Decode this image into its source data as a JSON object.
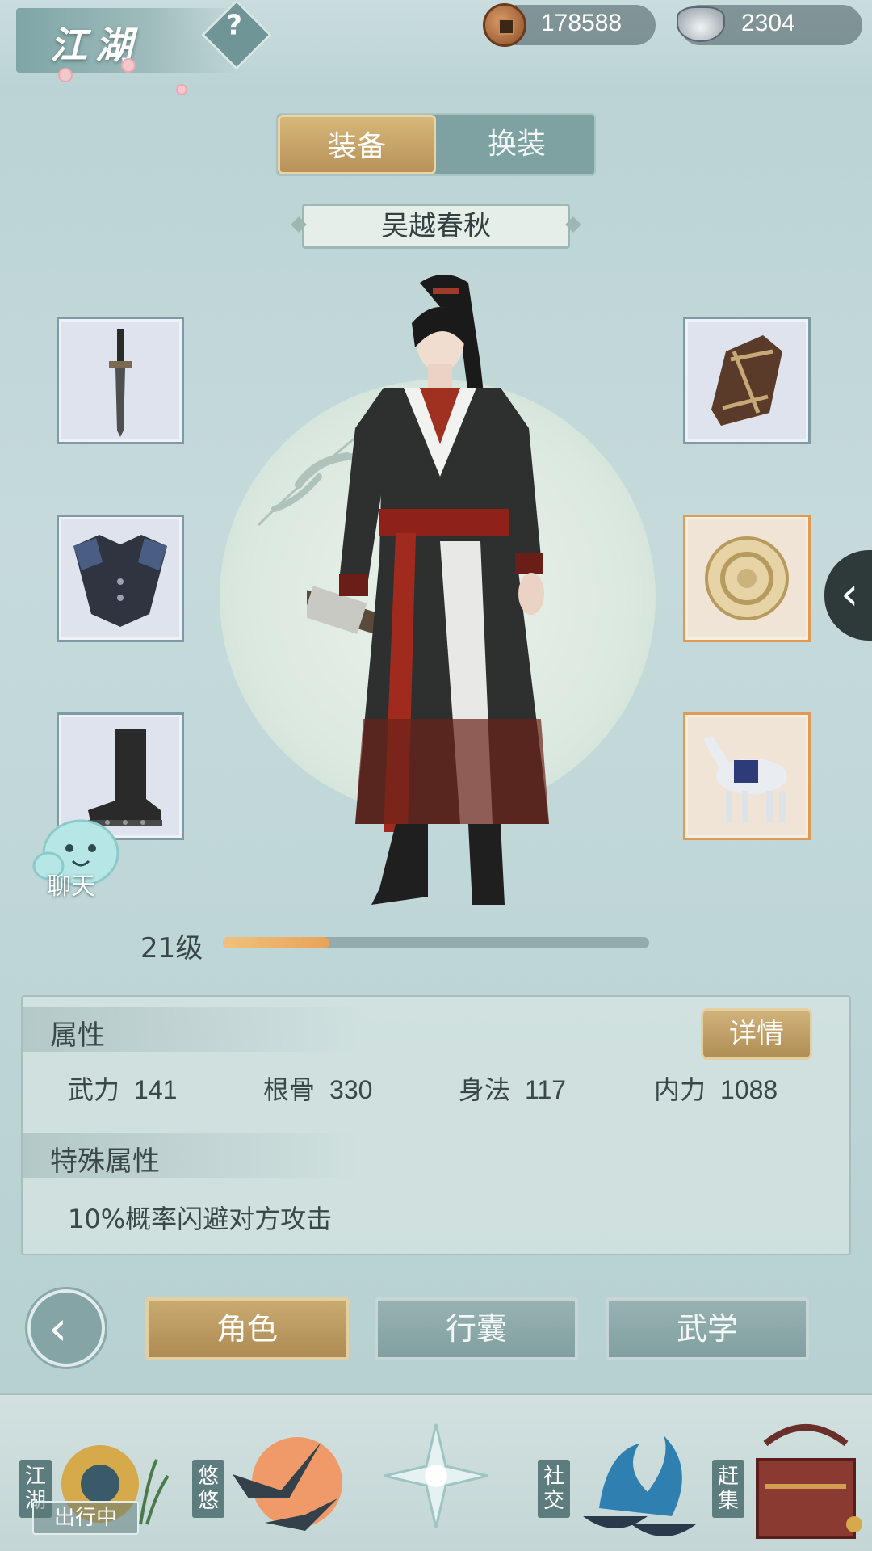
{
  "header": {
    "scene_title": "江湖",
    "help_symbol": "?",
    "currencies": [
      {
        "icon": "copper-coin-icon",
        "value": "178588"
      },
      {
        "icon": "silver-ingot-icon",
        "value": "2304"
      }
    ]
  },
  "tabs": {
    "active": "装备",
    "inactive": "换装"
  },
  "character": {
    "name": "吴越春秋",
    "level_label": "21级",
    "xp_fraction": 0.25
  },
  "equipment": {
    "left": [
      "sword-icon",
      "chest-armor-icon",
      "boots-icon"
    ],
    "right": [
      "bracer-icon",
      "jade-pendant-icon",
      "horse-mount-icon"
    ]
  },
  "side_toggle": "‹",
  "chat": {
    "label": "聊天"
  },
  "attributes": {
    "title": "属性",
    "detail_button": "详情",
    "stats": [
      {
        "name": "武力",
        "value": "141"
      },
      {
        "name": "根骨",
        "value": "330"
      },
      {
        "name": "身法",
        "value": "117"
      },
      {
        "name": "内力",
        "value": "1088"
      }
    ],
    "special_title": "特殊属性",
    "special_text": "10%概率闪避对方攻击"
  },
  "actions": {
    "back_symbol": "‹",
    "buttons": [
      "角色",
      "行囊",
      "武学"
    ],
    "active_index": 0
  },
  "bottom_nav": {
    "items": [
      "江湖",
      "悠悠",
      "",
      "社交",
      "赶集"
    ],
    "status_badge": "出行中"
  },
  "colors": {
    "gold_active": "#c9aa70",
    "teal_inactive": "#82a0a1",
    "slot_rare_border": "#e09a56",
    "xp_fill": "#e8a35a"
  }
}
